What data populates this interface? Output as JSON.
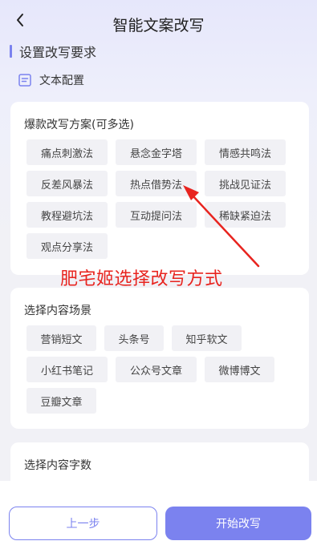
{
  "header": {
    "title": "智能文案改写"
  },
  "section": {
    "title": "设置改写要求",
    "config_label": "文本配置"
  },
  "rewrite_plan": {
    "title": "爆款改写方案(可多选)",
    "options": [
      "痛点刺激法",
      "悬念金字塔",
      "情感共鸣法",
      "反差风暴法",
      "热点借势法",
      "挑战见证法",
      "教程避坑法",
      "互动提问法",
      "稀缺紧迫法",
      "观点分享法"
    ]
  },
  "scene": {
    "title": "选择内容场景",
    "options": [
      "营销短文",
      "头条号",
      "知乎软文",
      "小红书笔记",
      "公众号文章",
      "微博博文",
      "豆瓣文章"
    ]
  },
  "word_count": {
    "title": "选择内容字数"
  },
  "annotation": {
    "text": "肥宅姬选择改写方式",
    "color": "#e8241f"
  },
  "footer": {
    "prev_label": "上一步",
    "start_label": "开始改写"
  },
  "colors": {
    "accent": "#7b82ef",
    "chip_bg": "#f1f1f5"
  }
}
